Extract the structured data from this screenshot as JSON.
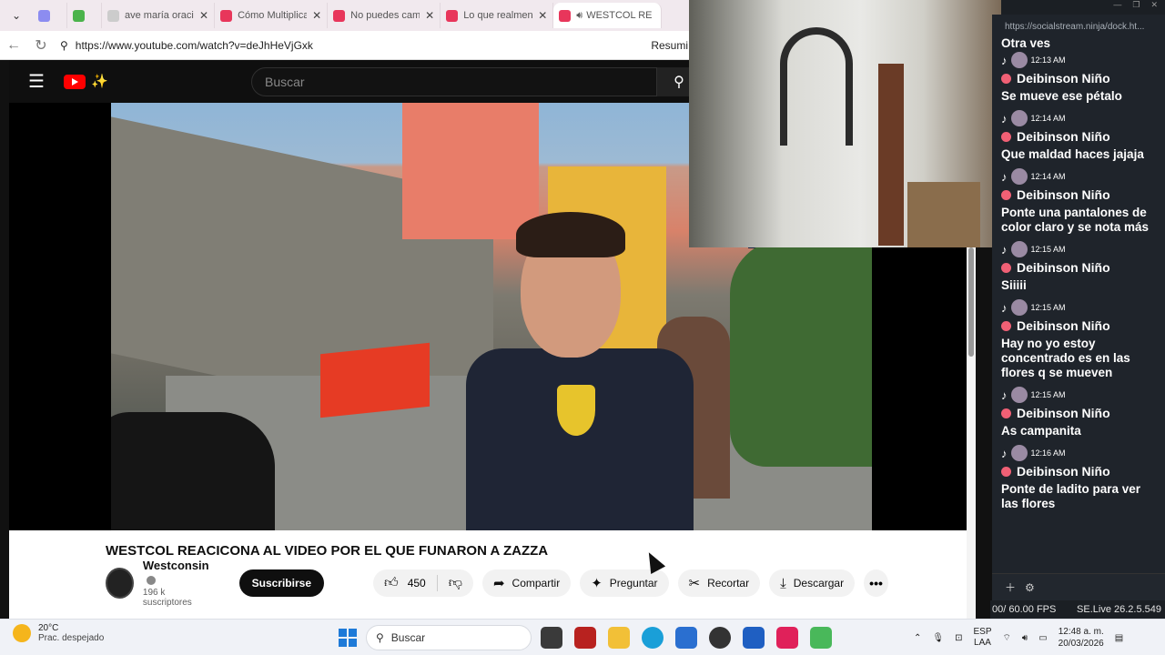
{
  "browser": {
    "tabs": [
      {
        "label": "",
        "color": "#8c8cf0"
      },
      {
        "label": "",
        "color": "#4bb34b"
      },
      {
        "label": "ave maría oración",
        "color": "#bbbbbb"
      },
      {
        "label": "Cómo Multiplicar",
        "color": "#e8365b"
      },
      {
        "label": "No puedes cambi",
        "color": "#e8365b"
      },
      {
        "label": "Lo que realmente",
        "color": "#e8365b"
      },
      {
        "label": "WESTCOL RE",
        "color": "#e8365b"
      }
    ],
    "url": "https://www.youtube.com/watch?v=deJhHeVjGxk",
    "resumir": "Resumi"
  },
  "youtube": {
    "search_placeholder": "Buscar",
    "video_title": "WESTCOL REACICONA AL VIDEO POR EL QUE FUNARON A ZAZZA",
    "channel_name": "Westconsin",
    "channel_subs": "196 k suscriptores",
    "subscribe_label": "Suscribirse",
    "like_count": "450",
    "share_label": "Compartir",
    "ask_label": "Preguntar",
    "clip_label": "Recortar",
    "download_label": "Descargar"
  },
  "chat": {
    "url": "https://socialstream.ninja/dock.ht...",
    "first_text": "Otra ves",
    "messages": [
      {
        "time": "12:13 AM",
        "user": "Deibinson Niño",
        "text": "Se mueve ese pétalo"
      },
      {
        "time": "12:14 AM",
        "user": "Deibinson Niño",
        "text": "Que maldad haces jajaja"
      },
      {
        "time": "12:14 AM",
        "user": "Deibinson Niño",
        "text": "Ponte una pantalones de color claro y se nota más"
      },
      {
        "time": "12:15 AM",
        "user": "Deibinson Niño",
        "text": "Siiiii"
      },
      {
        "time": "12:15 AM",
        "user": "Deibinson Niño",
        "text": "Hay no yo estoy concentrado es en las flores q se mueven"
      },
      {
        "time": "12:15 AM",
        "user": "Deibinson Niño",
        "text": "As campanita"
      },
      {
        "time": "12:16 AM",
        "user": "Deibinson Niño",
        "text": "Ponte de ladito para ver las flores"
      }
    ],
    "fps": "/ 60.00 FPS",
    "fps_prefix": "00",
    "version": "SE.Live 26.2.5.549"
  },
  "taskbar": {
    "temp": "20°C",
    "weather": "Prac. despejado",
    "search_placeholder": "Buscar",
    "lang_top": "ESP",
    "lang_bottom": "LAA",
    "time": "12:48 a. m.",
    "date": "20/03/2026"
  }
}
